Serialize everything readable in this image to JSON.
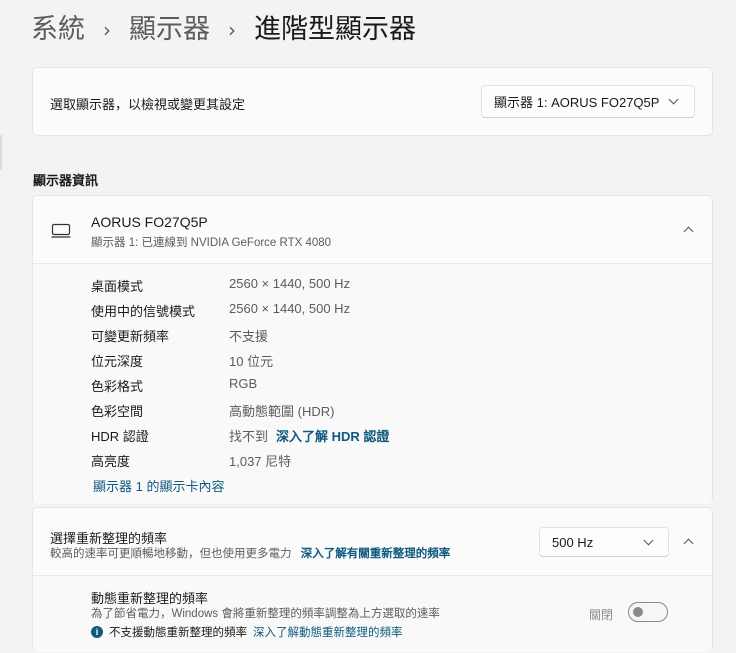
{
  "breadcrumb": {
    "items": [
      "系統",
      "顯示器",
      "進階型顯示器"
    ],
    "separator": "›"
  },
  "select_display": {
    "label": "選取顯示器，以檢視或變更其設定",
    "selected": "顯示器 1: AORUS FO27Q5P"
  },
  "section_title": "顯示器資訊",
  "monitor": {
    "name": "AORUS FO27Q5P",
    "subtitle": "顯示器 1: 已連線到 NVIDIA GeForce RTX 4080",
    "icon": "monitor-icon",
    "rows": [
      {
        "key": "桌面模式",
        "value": "2560 × 1440, 500 Hz"
      },
      {
        "key": "使用中的信號模式",
        "value": "2560 × 1440, 500 Hz"
      },
      {
        "key": "可變更新頻率",
        "value": "不支援"
      },
      {
        "key": "位元深度",
        "value": "10 位元"
      },
      {
        "key": "色彩格式",
        "value": "RGB"
      },
      {
        "key": "色彩空間",
        "value": "高動態範圍 (HDR)"
      }
    ],
    "hdr": {
      "key": "HDR 認證",
      "value": "找不到",
      "link": "深入了解 HDR 認證"
    },
    "brightness": {
      "key": "高亮度",
      "value": "1,037 尼特"
    },
    "adapter_link": "顯示器 1 的顯示卡內容"
  },
  "refresh": {
    "title": "選擇重新整理的頻率",
    "subtitle": "較高的速率可更順暢地移動，但也使用更多電力",
    "subtitle_link": "深入了解有關重新整理的頻率",
    "selected_rate": "500 Hz",
    "dynamic": {
      "title": "動態重新整理的頻率",
      "subtitle": "為了節省電力，Windows 會將重新整理的頻率調整為上方選取的速率",
      "note": "不支援動態重新整理的頻率",
      "note_link": "深入了解動態重新整理的頻率",
      "toggle_label": "關閉",
      "toggle_on": false
    }
  },
  "colors": {
    "accent_link": "#0f5a7e",
    "background": "#f3f3f3",
    "card": "#fbfbfb"
  }
}
